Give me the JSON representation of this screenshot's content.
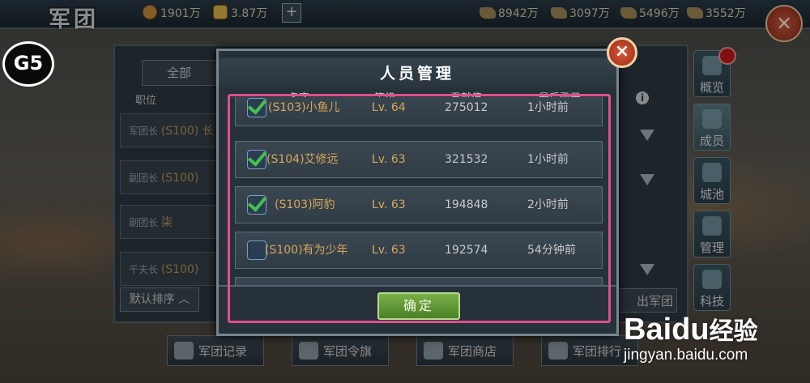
{
  "top_bar": {
    "title": "军团",
    "gold": "1901万",
    "ingot": "3.87万",
    "plus": "+",
    "res1": "8942万",
    "res2": "3097万",
    "res3": "5496万",
    "res4": "3552万",
    "close": "×"
  },
  "logo_text": "G5",
  "background": {
    "tab_all": "全部",
    "col_position": "职位",
    "rows": [
      {
        "role": "军团长",
        "name": "(S100) 长"
      },
      {
        "role": "副团长",
        "name": "(S100)"
      },
      {
        "role": "副团长",
        "name": "柒"
      },
      {
        "role": "千夫长",
        "name": "(S100)"
      }
    ],
    "sort_button": "默认排序",
    "leave_button": "出军团",
    "info": "i"
  },
  "side_tabs": [
    "概览",
    "成员",
    "城池",
    "管理",
    "科技"
  ],
  "bottom_bar": [
    "军团记录",
    "军团令旗",
    "军团商店",
    "军团排行"
  ],
  "modal": {
    "title": "人员管理",
    "close": "×",
    "columns": {
      "name": "名字",
      "level": "等级",
      "contribution": "贡献值",
      "last_login": "最后登录"
    },
    "members": [
      {
        "checked": true,
        "name": "(S103)小鱼儿",
        "level": "Lv. 64",
        "contribution": "275012",
        "last_login": "1小时前"
      },
      {
        "checked": true,
        "name": "(S104)艾修远",
        "level": "Lv. 63",
        "contribution": "321532",
        "last_login": "1小时前"
      },
      {
        "checked": true,
        "name": "(S103)阿豹",
        "level": "Lv. 63",
        "contribution": "194848",
        "last_login": "2小时前"
      },
      {
        "checked": false,
        "name": "(S100)有为少年",
        "level": "Lv. 63",
        "contribution": "192574",
        "last_login": "54分钟前"
      }
    ],
    "confirm": "确定"
  },
  "watermark": {
    "brand": "Baidu",
    "brand_cn": "经验",
    "url": "jingyan.baidu.com"
  },
  "colors": {
    "accent_green": "#45c24a",
    "highlight_pink": "#e0508a",
    "gold_text": "#d6a85a"
  }
}
